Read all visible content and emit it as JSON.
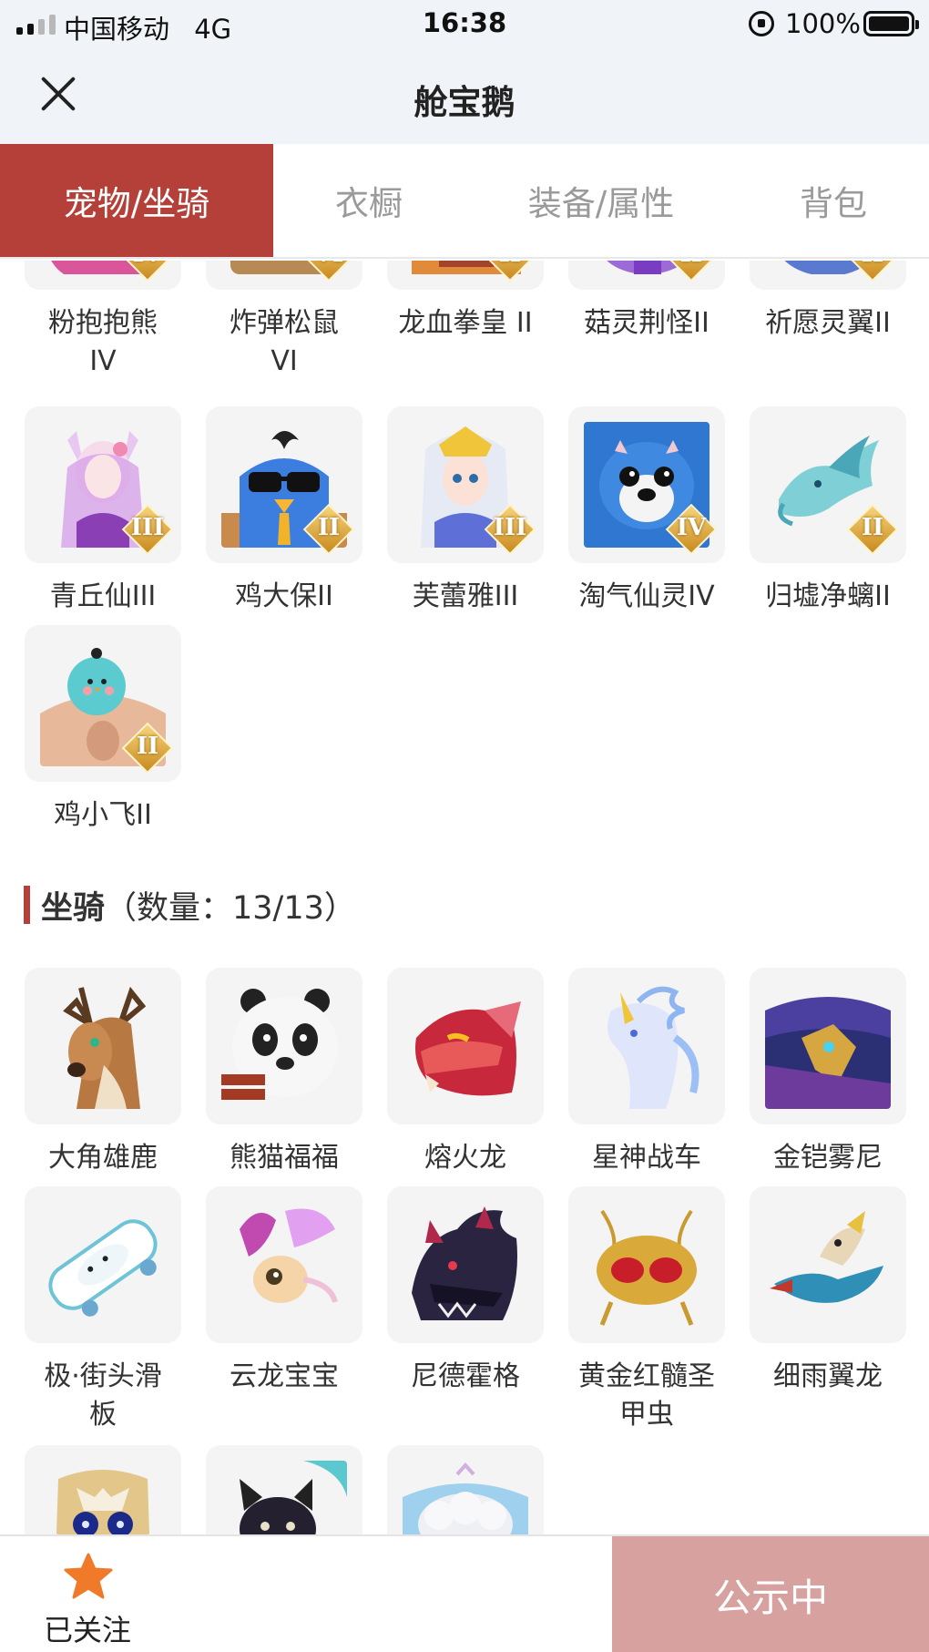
{
  "status_bar": {
    "carrier": "中国移动",
    "network": "4G",
    "time": "16:38",
    "battery": "100%"
  },
  "header": {
    "title": "舱宝鹅"
  },
  "tabs": [
    {
      "label": "宠物/坐骑",
      "active": true
    },
    {
      "label": "衣橱",
      "active": false
    },
    {
      "label": "装备/属性",
      "active": false
    },
    {
      "label": "背包",
      "active": false
    }
  ],
  "pets": [
    {
      "name": "粉抱抱熊\nIV",
      "rank": "IV",
      "art": "bear"
    },
    {
      "name": "炸弹松鼠\nVI",
      "rank": "VI",
      "art": "squirrel"
    },
    {
      "name": "龙血拳皇 II",
      "rank": "II",
      "art": "boxer"
    },
    {
      "name": "菇灵荆怪II",
      "rank": "II",
      "art": "mushroom"
    },
    {
      "name": "祈愿灵翼II",
      "rank": "II",
      "art": "wing"
    },
    {
      "name": "青丘仙III",
      "rank": "III",
      "art": "fox-girl"
    },
    {
      "name": "鸡大保II",
      "rank": "II",
      "art": "chicken"
    },
    {
      "name": "芙蕾雅III",
      "rank": "III",
      "art": "freya"
    },
    {
      "name": "淘气仙灵IV",
      "rank": "IV",
      "art": "puppy"
    },
    {
      "name": "归墟净螭II",
      "rank": "II",
      "art": "sea-dragon"
    },
    {
      "name": "鸡小飞II",
      "rank": "II",
      "art": "chick"
    }
  ],
  "mount_section": {
    "title": "坐骑",
    "count_text": "（数量：13/13）"
  },
  "mounts": [
    {
      "name": "大角雄鹿",
      "art": "deer"
    },
    {
      "name": "熊猫福福",
      "art": "panda"
    },
    {
      "name": "熔火龙",
      "art": "fire-dragon"
    },
    {
      "name": "星神战车",
      "art": "ice-horse"
    },
    {
      "name": "金铠雾尼",
      "art": "armored-bird"
    },
    {
      "name": "极·街头滑\n板",
      "art": "skateboard"
    },
    {
      "name": "云龙宝宝",
      "art": "cloud-dragon"
    },
    {
      "name": "尼德霍格",
      "art": "dark-dragon"
    },
    {
      "name": "黄金红髓圣\n甲虫",
      "art": "golden-beetle"
    },
    {
      "name": "细雨翼龙",
      "art": "pterosaur"
    },
    {
      "name": "",
      "art": "owl"
    },
    {
      "name": "",
      "art": "black-cat"
    },
    {
      "name": "",
      "art": "sheep"
    }
  ],
  "bottom_bar": {
    "follow_label": "已关注",
    "public_label": "公示中"
  },
  "colors": {
    "accent": "#b53f39",
    "public_button": "#d6a19f",
    "star": "#f07a2a",
    "rank_badge": "#e0a53c"
  }
}
